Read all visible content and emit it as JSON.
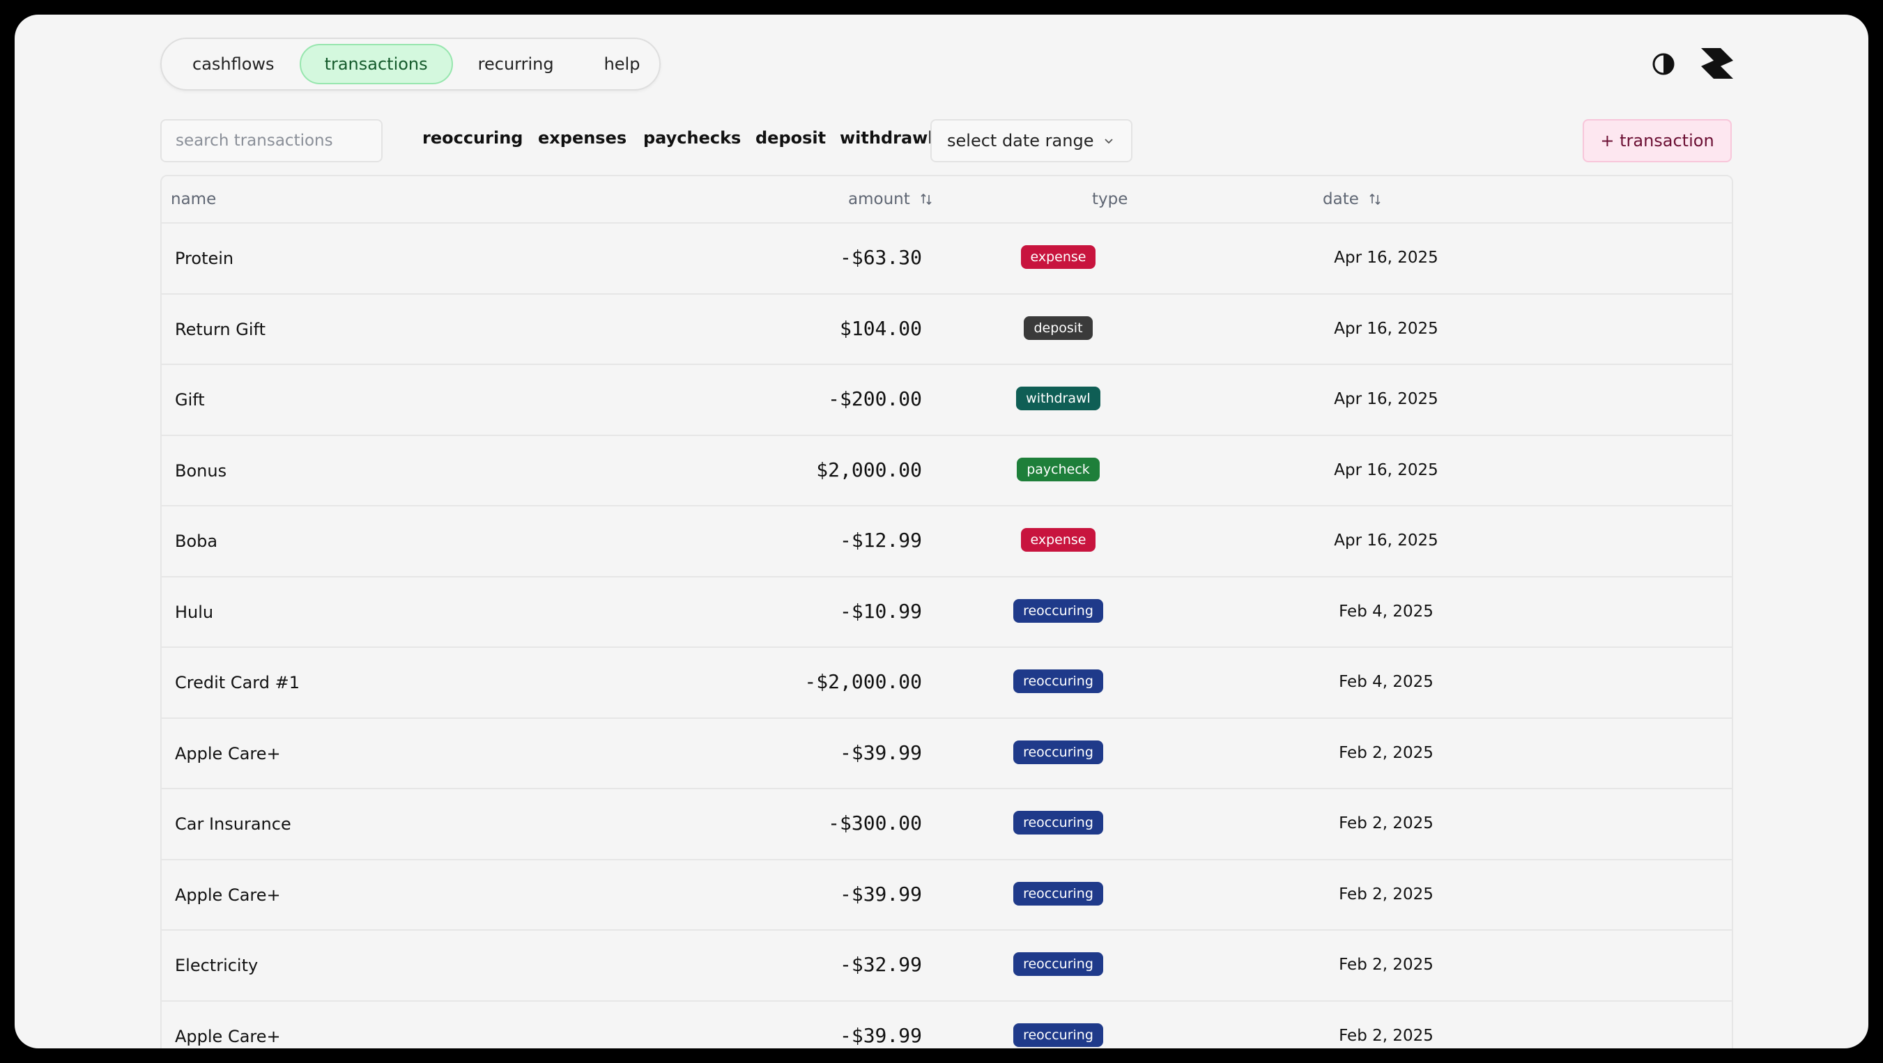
{
  "nav": {
    "tabs": [
      {
        "label": "cashflows",
        "active": false
      },
      {
        "label": "transactions",
        "active": true
      },
      {
        "label": "recurring",
        "active": false
      },
      {
        "label": "help",
        "active": false
      }
    ]
  },
  "header": {
    "theme_icon": "contrast-icon",
    "logo_icon": "app-logo-icon"
  },
  "toolbar": {
    "search_placeholder": "search transactions",
    "filters": [
      "reoccuring",
      "expenses",
      "paychecks",
      "deposit",
      "withdrawl"
    ],
    "date_range_label": "select date range",
    "add_label": "+ transaction"
  },
  "table": {
    "columns": {
      "name": "name",
      "amount": "amount",
      "type": "type",
      "date": "date"
    },
    "rows": [
      {
        "name": "Protein",
        "amount": "-$63.30",
        "type": "expense",
        "date": "Apr 16, 2025"
      },
      {
        "name": "Return Gift",
        "amount": "$104.00",
        "type": "deposit",
        "date": "Apr 16, 2025"
      },
      {
        "name": "Gift",
        "amount": "-$200.00",
        "type": "withdrawl",
        "date": "Apr 16, 2025"
      },
      {
        "name": "Bonus",
        "amount": "$2,000.00",
        "type": "paycheck",
        "date": "Apr 16, 2025"
      },
      {
        "name": "Boba",
        "amount": "-$12.99",
        "type": "expense",
        "date": "Apr 16, 2025"
      },
      {
        "name": "Hulu",
        "amount": "-$10.99",
        "type": "reoccuring",
        "date": "Feb 4, 2025"
      },
      {
        "name": "Credit Card #1",
        "amount": "-$2,000.00",
        "type": "reoccuring",
        "date": "Feb 4, 2025"
      },
      {
        "name": "Apple Care+",
        "amount": "-$39.99",
        "type": "reoccuring",
        "date": "Feb 2, 2025"
      },
      {
        "name": "Car Insurance",
        "amount": "-$300.00",
        "type": "reoccuring",
        "date": "Feb 2, 2025"
      },
      {
        "name": "Apple Care+",
        "amount": "-$39.99",
        "type": "reoccuring",
        "date": "Feb 2, 2025"
      },
      {
        "name": "Electricity",
        "amount": "-$32.99",
        "type": "reoccuring",
        "date": "Feb 2, 2025"
      },
      {
        "name": "Apple Care+",
        "amount": "-$39.99",
        "type": "reoccuring",
        "date": "Feb 2, 2025"
      }
    ]
  },
  "type_colors": {
    "expense": "#c8143e",
    "deposit": "#3a3a3a",
    "withdrawl": "#0f5e55",
    "paycheck": "#1e7f3a",
    "reoccuring": "#1f3a8a"
  }
}
